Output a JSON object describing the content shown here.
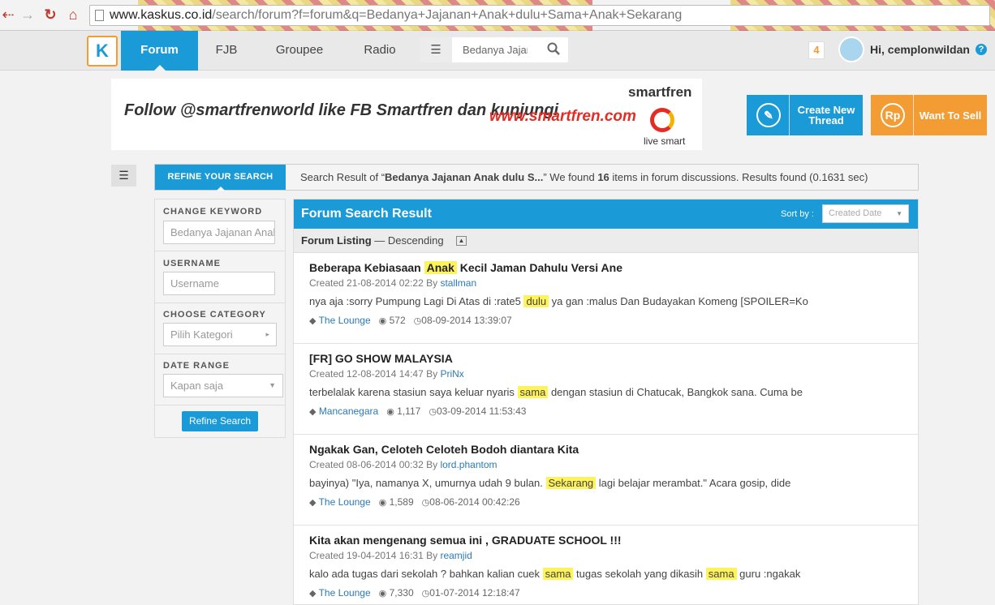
{
  "browser": {
    "url_host": "www.kaskus.co.id",
    "url_rest": "/search/forum?f=forum&q=Bedanya+Jajanan+Anak+dulu+Sama+Anak+Sekarang"
  },
  "nav": {
    "tabs": [
      "Forum",
      "FJB",
      "Groupee",
      "Radio"
    ],
    "search_text": "Bedanya Jajan",
    "notif_count": "4",
    "greeting": "Hi, cemplonwildan",
    "help": "?"
  },
  "banner": {
    "text1": "Follow @smartfrenworld like FB Smartfren dan kunjungi",
    "text2": "www.smartfren.com",
    "brand": "smartfren",
    "tagline": "live smart"
  },
  "actions": {
    "create_label": "Create New Thread",
    "sell_icon": "Rp",
    "sell_label": "Want To Sell"
  },
  "refine": {
    "tab_label": "REFINE YOUR SEARCH",
    "summary_pre": "Search Result of “",
    "summary_query": "Bedanya Jajanan Anak dulu S...",
    "summary_mid": "” We found ",
    "summary_count": "16",
    "summary_post": " items in forum discussions. Results found (0.1631 sec)"
  },
  "sidebar": {
    "keyword_label": "CHANGE KEYWORD",
    "keyword_value": "Bedanya Jajanan Anak dulu",
    "username_label": "USERNAME",
    "username_placeholder": "Username",
    "category_label": "CHOOSE CATEGORY",
    "category_value": "Pilih Kategori",
    "date_label": "DATE RANGE",
    "date_value": "Kapan saja",
    "refine_button": "Refine Search"
  },
  "results": {
    "title": "Forum Search Result",
    "sort_label": "Sort by :",
    "sort_value": "Created Date",
    "listing_label": "Forum Listing",
    "listing_order": "— Descending",
    "items": [
      {
        "title_pre": "Beberapa Kebiasaan ",
        "title_hl": "Anak",
        "title_post": " Kecil Jaman Dahulu Versi Ane",
        "created": "Created 21-08-2014 02:22 By ",
        "author": "stallman",
        "snip_pre": "nya aja :sorry Pumpung Lagi Di Atas di :rate5 ",
        "snip_hl": "dulu",
        "snip_post": " ya gan :malus Dan Budayakan Komeng [SPOILER=Ko",
        "category": "The Lounge",
        "views": "572",
        "last": "08-09-2014 13:39:07"
      },
      {
        "title_pre": "[FR] GO SHOW MALAYSIA",
        "title_hl": "",
        "title_post": "",
        "created": "Created 12-08-2014 14:47 By ",
        "author": "PriNx",
        "snip_pre": "terbelalak karena stasiun saya keluar nyaris ",
        "snip_hl": "sama",
        "snip_post": " dengan stasiun di Chatucak, Bangkok sana. Cuma be",
        "category": "Mancanegara",
        "views": "1,117",
        "last": "03-09-2014 11:53:43"
      },
      {
        "title_pre": "Ngakak Gan, Celoteh Celoteh Bodoh diantara Kita",
        "title_hl": "",
        "title_post": "",
        "created": "Created 08-06-2014 00:32 By ",
        "author": "lord.phantom",
        "snip_pre": "bayinya) \"Iya, namanya X, umurnya udah 9 bulan. ",
        "snip_hl": "Sekarang",
        "snip_post": " lagi belajar merambat.\" Acara gosip, dide",
        "category": "The Lounge",
        "views": "1,589",
        "last": "08-06-2014 00:42:26"
      },
      {
        "title_pre": "Kita akan mengenang semua ini , GRADUATE SCHOOL !!!",
        "title_hl": "",
        "title_post": "",
        "created": "Created 19-04-2014 16:31 By ",
        "author": "reamjid",
        "snip_pre": "kalo ada tugas dari sekolah ? bahkan kalian cuek ",
        "snip_hl": "sama",
        "snip_mid": " tugas sekolah yang dikasih ",
        "snip_hl2": "sama",
        "snip_post": " guru :ngakak",
        "category": "The Lounge",
        "views": "7,330",
        "last": "01-07-2014 12:18:47"
      }
    ]
  }
}
